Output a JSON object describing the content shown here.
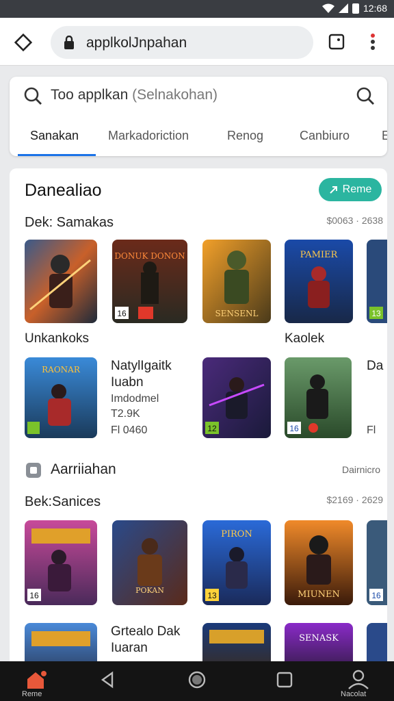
{
  "status_bar": {
    "time": "12:68"
  },
  "url_bar": {
    "url": "applkolJnpahan"
  },
  "search": {
    "query": "Too applkan",
    "hint": "(Selnakohan)"
  },
  "tabs": [
    "Sanakan",
    "Markadoriction",
    "Renog",
    "Canbiuro",
    "E"
  ],
  "section1": {
    "title": "Danealiao",
    "button_label": "Reme",
    "subheading": "Dek: Samakas",
    "meta": "$0063 · 2638",
    "row1_label_left": "Unkankoks",
    "row1_label_right": "Kaolek",
    "featured_info": {
      "title": "NatylIgaitk",
      "subtitle": "Iuabn",
      "line1": "Imdodmel",
      "line2": "T2.9K",
      "line3": "Fl 0460"
    },
    "right_info": {
      "title": "Da",
      "line3": "Fl"
    }
  },
  "section2": {
    "title": "Aarriiahan",
    "right_label": "Dairnicro",
    "subheading": "Bek:Sanices",
    "meta": "$2169 · 2629",
    "featured_info": {
      "title": "Grtealo Dak",
      "subtitle": "Iuaran"
    }
  },
  "tile_texts": {
    "t2": "DONUK DONON",
    "t3": "SENSENL",
    "t4": "PAMIER",
    "t6": "RAONAR",
    "t10": "POKAN",
    "t11": "PIRON",
    "t12": "MIUNEN",
    "t15": "SENASK"
  },
  "age_badges": {
    "t2": "16",
    "t5": "13",
    "t7": "12",
    "t8": "16",
    "t9": "16",
    "t11": "13",
    "t13": "16"
  },
  "bottom_nav": {
    "home_label": "Reme",
    "profile_label": "Nacolat"
  },
  "colors": {
    "accent": "#2bb5a0",
    "tab_active": "#1a73e8",
    "home_active": "#e8583a"
  }
}
